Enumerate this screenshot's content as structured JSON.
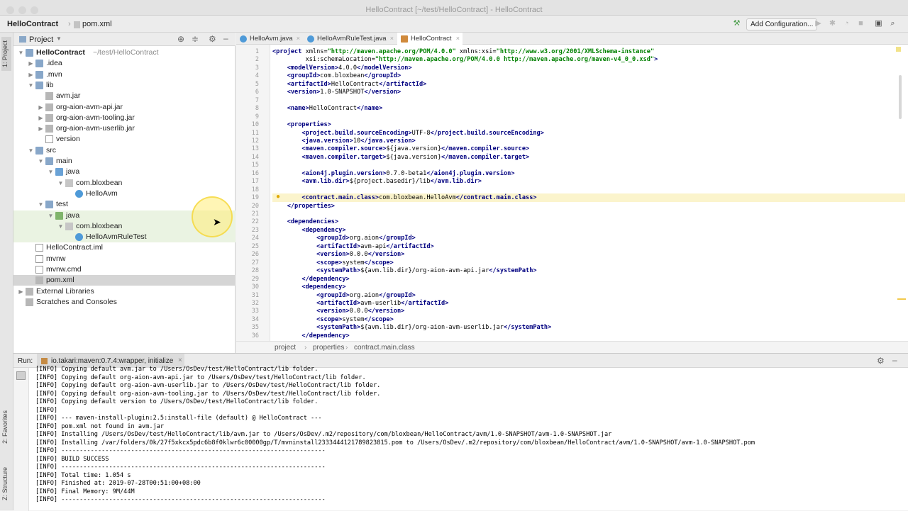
{
  "window": {
    "title": "HelloContract [~/test/HelloContract] - HelloContract"
  },
  "navbar": {
    "project": "HelloContract",
    "file": "pom.xml",
    "add_config": "Add Configuration..."
  },
  "left_tabs": {
    "project": "1: Project",
    "favorites": "2: Favorites",
    "structure": "Z: Structure"
  },
  "project_panel": {
    "title": "Project"
  },
  "tree": [
    {
      "label": "HelloContract",
      "hint": "~/test/HelloContract",
      "depth": 0,
      "arrow": "▼",
      "icon": "folder-icon",
      "bold": true
    },
    {
      "label": ".idea",
      "depth": 1,
      "arrow": "▶",
      "icon": "folder-icon"
    },
    {
      "label": ".mvn",
      "depth": 1,
      "arrow": "▶",
      "icon": "folder-icon"
    },
    {
      "label": "lib",
      "depth": 1,
      "arrow": "▼",
      "icon": "folder-icon"
    },
    {
      "label": "avm.jar",
      "depth": 2,
      "arrow": "",
      "icon": "jar-icon"
    },
    {
      "label": "org-aion-avm-api.jar",
      "depth": 2,
      "arrow": "▶",
      "icon": "jar-icon"
    },
    {
      "label": "org-aion-avm-tooling.jar",
      "depth": 2,
      "arrow": "▶",
      "icon": "jar-icon"
    },
    {
      "label": "org-aion-avm-userlib.jar",
      "depth": 2,
      "arrow": "▶",
      "icon": "jar-icon"
    },
    {
      "label": "version",
      "depth": 2,
      "arrow": "",
      "icon": "file-icon"
    },
    {
      "label": "src",
      "depth": 1,
      "arrow": "▼",
      "icon": "folder-icon"
    },
    {
      "label": "main",
      "depth": 2,
      "arrow": "▼",
      "icon": "folder-icon"
    },
    {
      "label": "java",
      "depth": 3,
      "arrow": "▼",
      "icon": "source-folder-icon"
    },
    {
      "label": "com.bloxbean",
      "depth": 4,
      "arrow": "▼",
      "icon": "package-icon"
    },
    {
      "label": "HelloAvm",
      "depth": 5,
      "arrow": "",
      "icon": "class-icon"
    },
    {
      "label": "test",
      "depth": 2,
      "arrow": "▼",
      "icon": "folder-icon"
    },
    {
      "label": "java",
      "depth": 3,
      "arrow": "▼",
      "icon": "test-folder-icon",
      "green": true
    },
    {
      "label": "com.bloxbean",
      "depth": 4,
      "arrow": "▼",
      "icon": "package-icon",
      "green": true
    },
    {
      "label": "HelloAvmRuleTest",
      "depth": 5,
      "arrow": "",
      "icon": "class-icon",
      "green": true
    },
    {
      "label": "HelloContract.iml",
      "depth": 1,
      "arrow": "",
      "icon": "file-icon"
    },
    {
      "label": "mvnw",
      "depth": 1,
      "arrow": "",
      "icon": "file-icon"
    },
    {
      "label": "mvnw.cmd",
      "depth": 1,
      "arrow": "",
      "icon": "file-icon"
    },
    {
      "label": "pom.xml",
      "depth": 1,
      "arrow": "",
      "icon": "maven-icon",
      "selected": true
    },
    {
      "label": "External Libraries",
      "depth": 0,
      "arrow": "▶",
      "icon": "library-icon"
    },
    {
      "label": "Scratches and Consoles",
      "depth": 0,
      "arrow": "",
      "icon": "scratch-icon"
    }
  ],
  "tabs": [
    {
      "label": "HelloAvm.java",
      "color": "#4e9ad8"
    },
    {
      "label": "HelloAvmRuleTest.java",
      "color": "#4e9ad8"
    },
    {
      "label": "HelloContract",
      "color": "#d08a3c",
      "active": true
    }
  ],
  "code_lines": [
    {
      "n": "1",
      "t": "<project xmlns=\"http://maven.apache.org/POM/4.0.0\" xmlns:xsi=\"http://www.w3.org/2001/XMLSchema-instance\""
    },
    {
      "n": "2",
      "t": "         xsi:schemaLocation=\"http://maven.apache.org/POM/4.0.0 http://maven.apache.org/maven-v4_0_0.xsd\">"
    },
    {
      "n": "3",
      "t": "    <modelVersion>4.0.0</modelVersion>"
    },
    {
      "n": "4",
      "t": "    <groupId>com.bloxbean</groupId>"
    },
    {
      "n": "5",
      "t": "    <artifactId>HelloContract</artifactId>"
    },
    {
      "n": "6",
      "t": "    <version>1.0-SNAPSHOT</version>"
    },
    {
      "n": "7",
      "t": ""
    },
    {
      "n": "8",
      "t": "    <name>HelloContract</name>"
    },
    {
      "n": "9",
      "t": ""
    },
    {
      "n": "10",
      "t": "    <properties>"
    },
    {
      "n": "11",
      "t": "        <project.build.sourceEncoding>UTF-8</project.build.sourceEncoding>"
    },
    {
      "n": "12",
      "t": "        <java.version>10</java.version>"
    },
    {
      "n": "13",
      "t": "        <maven.compiler.source>${java.version}</maven.compiler.source>"
    },
    {
      "n": "14",
      "t": "        <maven.compiler.target>${java.version}</maven.compiler.target>"
    },
    {
      "n": "15",
      "t": ""
    },
    {
      "n": "16",
      "t": "        <aion4j.plugin.version>0.7.0-beta1</aion4j.plugin.version>"
    },
    {
      "n": "17",
      "t": "        <avm.lib.dir>${project.basedir}/lib</avm.lib.dir>"
    },
    {
      "n": "18",
      "t": ""
    },
    {
      "n": "19",
      "t": "        <contract.main.class>com.bloxbean.HelloAvm</contract.main.class>"
    },
    {
      "n": "20",
      "t": "    </properties>"
    },
    {
      "n": "21",
      "t": ""
    },
    {
      "n": "22",
      "t": "    <dependencies>"
    },
    {
      "n": "23",
      "t": "        <dependency>"
    },
    {
      "n": "24",
      "t": "            <groupId>org.aion</groupId>"
    },
    {
      "n": "25",
      "t": "            <artifactId>avm-api</artifactId>"
    },
    {
      "n": "26",
      "t": "            <version>0.0.0</version>"
    },
    {
      "n": "27",
      "t": "            <scope>system</scope>"
    },
    {
      "n": "28",
      "t": "            <systemPath>${avm.lib.dir}/org-aion-avm-api.jar</systemPath>"
    },
    {
      "n": "29",
      "t": "        </dependency>"
    },
    {
      "n": "30",
      "t": "        <dependency>"
    },
    {
      "n": "31",
      "t": "            <groupId>org.aion</groupId>"
    },
    {
      "n": "32",
      "t": "            <artifactId>avm-userlib</artifactId>"
    },
    {
      "n": "33",
      "t": "            <version>0.0.0</version>"
    },
    {
      "n": "34",
      "t": "            <scope>system</scope>"
    },
    {
      "n": "35",
      "t": "            <systemPath>${avm.lib.dir}/org-aion-avm-userlib.jar</systemPath>"
    },
    {
      "n": "36",
      "t": "        </dependency>"
    }
  ],
  "breadcrumbs": [
    "project",
    "properties",
    "contract.main.class"
  ],
  "run": {
    "label": "Run:",
    "tab": "io.takari:maven:0.7.4:wrapper, initialize",
    "lines": [
      "[INFO] Copying default avm.jar to /Users/OsDev/test/HelloContract/lib folder.",
      "[INFO] Copying default org-aion-avm-api.jar to /Users/OsDev/test/HelloContract/lib folder.",
      "[INFO] Copying default org-aion-avm-userlib.jar to /Users/OsDev/test/HelloContract/lib folder.",
      "[INFO] Copying default org-aion-avm-tooling.jar to /Users/OsDev/test/HelloContract/lib folder.",
      "[INFO] Copying default version to /Users/OsDev/test/HelloContract/lib folder.",
      "[INFO]",
      "[INFO] --- maven-install-plugin:2.5:install-file (default) @ HelloContract ---",
      "[INFO] pom.xml not found in avm.jar",
      "[INFO] Installing /Users/OsDev/test/HelloContract/lib/avm.jar to /Users/OsDev/.m2/repository/com/bloxbean/HelloContract/avm/1.0-SNAPSHOT/avm-1.0-SNAPSHOT.jar",
      "[INFO] Installing /var/folders/0k/27f5xkcx5pdc6b8f0klwr6c00000gp/T/mvninstall2333444121789823815.pom to /Users/OsDev/.m2/repository/com/bloxbean/HelloContract/avm/1.0-SNAPSHOT/avm-1.0-SNAPSHOT.pom",
      "[INFO] ------------------------------------------------------------------------",
      "[INFO] BUILD SUCCESS",
      "[INFO] ------------------------------------------------------------------------",
      "[INFO] Total time: 1.054 s",
      "[INFO] Finished at: 2019-07-28T00:51:00+08:00",
      "[INFO] Final Memory: 9M/44M",
      "[INFO] ------------------------------------------------------------------------"
    ]
  }
}
